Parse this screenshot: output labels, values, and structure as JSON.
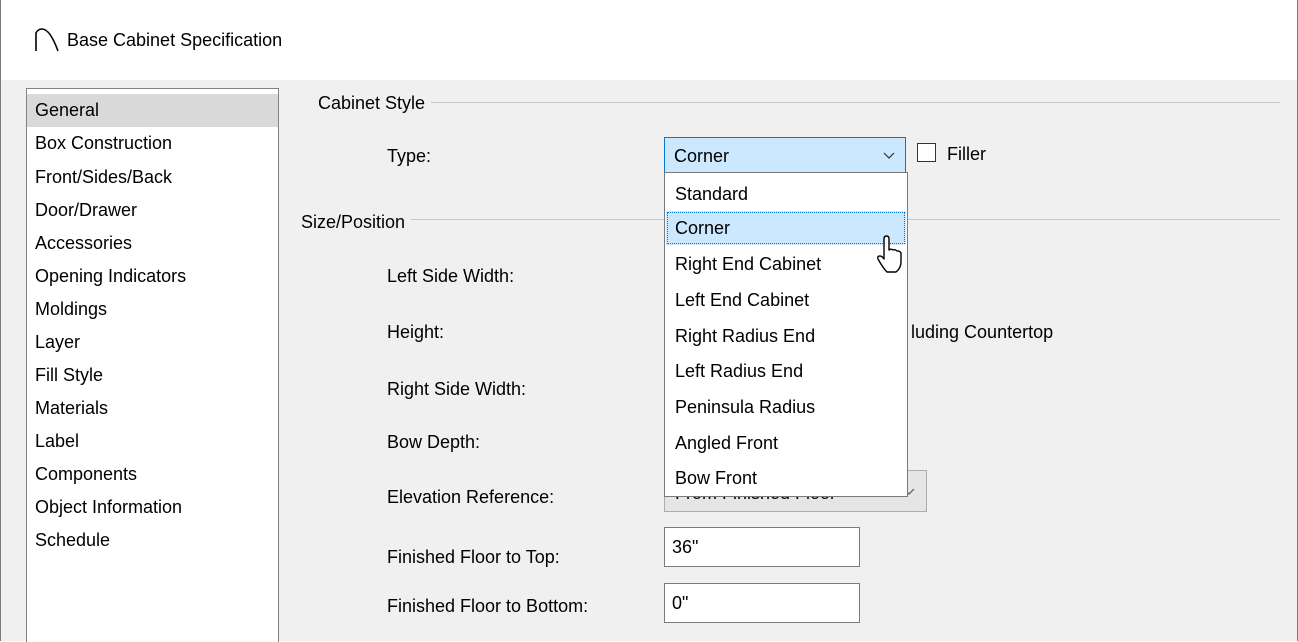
{
  "window": {
    "title": "Base Cabinet Specification",
    "icon": "cabinet-arc-icon"
  },
  "nav": {
    "items": [
      {
        "label": "General",
        "selected": true
      },
      {
        "label": "Box Construction"
      },
      {
        "label": "Front/Sides/Back"
      },
      {
        "label": "Door/Drawer"
      },
      {
        "label": "Accessories"
      },
      {
        "label": "Opening Indicators"
      },
      {
        "label": "Moldings"
      },
      {
        "label": "Layer"
      },
      {
        "label": "Fill Style"
      },
      {
        "label": "Materials"
      },
      {
        "label": "Label"
      },
      {
        "label": "Components"
      },
      {
        "label": "Object Information"
      },
      {
        "label": "Schedule"
      }
    ]
  },
  "cabinet_style": {
    "group_label": "Cabinet Style",
    "type_label": "Type:",
    "type_value": "Corner",
    "filler_label": "Filler",
    "filler_checked": false
  },
  "size_position": {
    "group_label": "Size/Position",
    "left_side_width_label": "Left Side Width:",
    "height_label": "Height:",
    "height_suffix_partial": "luding Countertop",
    "right_side_width_label": "Right Side Width:",
    "bow_depth_label": "Bow Depth:",
    "elevation_reference_label": "Elevation Reference:",
    "elevation_reference_value": "From Finished Floor",
    "finished_floor_to_top_label": "Finished Floor to Top:",
    "finished_floor_to_top_value": "36\"",
    "finished_floor_to_bottom_label": "Finished Floor to Bottom:",
    "finished_floor_to_bottom_value": "0\""
  },
  "type_dropdown": {
    "options": [
      "Standard",
      "Corner",
      "Right End Cabinet",
      "Left End Cabinet",
      "Right Radius End",
      "Left Radius End",
      "Peninsula Radius",
      "Angled Front",
      "Bow Front"
    ],
    "highlighted": "Corner"
  },
  "colors": {
    "selection_bg": "#cce8ff",
    "focus_border": "#0078d7",
    "nav_selected_bg": "#d9d9d9",
    "dialog_bg": "#f0f0f0"
  }
}
